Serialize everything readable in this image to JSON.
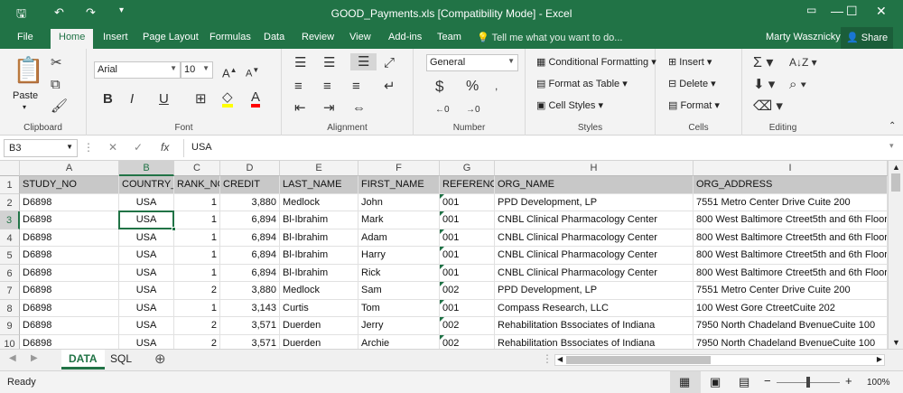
{
  "window": {
    "title": "GOOD_Payments.xls  [Compatibility Mode] - Excel",
    "save_icon": "save-icon",
    "minimize": "—",
    "maximize": "☐",
    "close": "✕",
    "restore_ribbon": "▭"
  },
  "tabs": [
    "File",
    "Home",
    "Insert",
    "Page Layout",
    "Formulas",
    "Data",
    "Review",
    "View",
    "Add-ins",
    "Team"
  ],
  "active_tab": "Home",
  "tell_me": "Tell me what you want to do...",
  "user": "Marty Wasznicky",
  "share": "Share",
  "ribbon": {
    "clipboard": {
      "label": "Clipboard",
      "paste": "Paste"
    },
    "font": {
      "label": "Font",
      "name": "Arial",
      "size": "10"
    },
    "alignment": {
      "label": "Alignment"
    },
    "number": {
      "label": "Number",
      "format": "General"
    },
    "styles": {
      "label": "Styles",
      "conditional": "Conditional Formatting",
      "format_table": "Format as Table",
      "cell_styles": "Cell Styles"
    },
    "cells": {
      "label": "Cells",
      "insert": "Insert",
      "delete": "Delete",
      "format": "Format"
    },
    "editing": {
      "label": "Editing"
    }
  },
  "formula_bar": {
    "name_box": "B3",
    "value": "USA",
    "fx": "fx"
  },
  "columns": [
    "A",
    "B",
    "C",
    "D",
    "E",
    "F",
    "G",
    "H",
    "I"
  ],
  "selected_column": "B",
  "selected_row": "3",
  "row_numbers": [
    "1",
    "2",
    "3",
    "4",
    "5",
    "6",
    "7",
    "8",
    "9",
    "10"
  ],
  "header_row": [
    "STUDY_NO",
    "COUNTRY_",
    "RANK_NO",
    "CREDIT",
    "LAST_NAME",
    "FIRST_NAME",
    "REFERENC",
    "ORG_NAME",
    "ORG_ADDRESS"
  ],
  "rows": [
    [
      "D6898",
      "USA",
      "1",
      "3,880",
      "Medlock",
      "John",
      "001",
      "PPD Development, LP",
      "7551 Metro Center Drive Cuite 200"
    ],
    [
      "D6898",
      "USA",
      "1",
      "6,894",
      "Bl-Ibrahim",
      "Mark",
      "001",
      "CNBL Clinical Pharmacology Center",
      "800 West Baltimore Ctreet5th and 6th Floor"
    ],
    [
      "D6898",
      "USA",
      "1",
      "6,894",
      "Bl-Ibrahim",
      "Adam",
      "001",
      "CNBL Clinical Pharmacology Center",
      "800 West Baltimore Ctreet5th and 6th Floor"
    ],
    [
      "D6898",
      "USA",
      "1",
      "6,894",
      "Bl-Ibrahim",
      "Harry",
      "001",
      "CNBL Clinical Pharmacology Center",
      "800 West Baltimore Ctreet5th and 6th Floor"
    ],
    [
      "D6898",
      "USA",
      "1",
      "6,894",
      "Bl-Ibrahim",
      "Rick",
      "001",
      "CNBL Clinical Pharmacology Center",
      "800 West Baltimore Ctreet5th and 6th Floor"
    ],
    [
      "D6898",
      "USA",
      "2",
      "3,880",
      "Medlock",
      "Sam",
      "002",
      "PPD Development, LP",
      "7551 Metro Center Drive Cuite 200"
    ],
    [
      "D6898",
      "USA",
      "1",
      "3,143",
      "Curtis",
      "Tom",
      "001",
      "Compass Research, LLC",
      "100 West Gore CtreetCuite 202"
    ],
    [
      "D6898",
      "USA",
      "2",
      "3,571",
      "Duerden",
      "Jerry",
      "002",
      "Rehabilitation Bssociates of Indiana",
      "7950 North Chadeland BvenueCuite 100"
    ],
    [
      "D6898",
      "USA",
      "2",
      "3,571",
      "Duerden",
      "Archie",
      "002",
      "Rehabilitation Bssociates of Indiana",
      "7950 North Chadeland BvenueCuite 100"
    ]
  ],
  "sheet_tabs": [
    "DATA",
    "SQL"
  ],
  "active_sheet": "DATA",
  "status": {
    "ready": "Ready",
    "zoom": "100%"
  }
}
